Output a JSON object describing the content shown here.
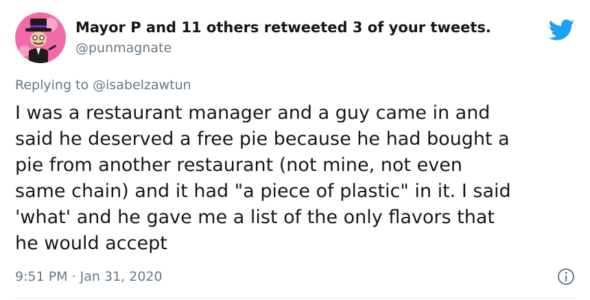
{
  "tweet": {
    "retweet_notice": "Mayor P and 11 others retweeted 3 of your tweets.",
    "handle": "@punmagnate",
    "replying_to": "Replying to @isabelzawtun",
    "text": "I was a restaurant manager and a guy came in and\nsaid he deserved a free pie because he had bought a\npie from another restaurant (not mine, not even\nsame chain) and it had \"a piece of plastic\" in it. I said\n'what' and he gave me a list of the only flavors that\nhe would accept",
    "timestamp": "9:51 PM · Jan 31, 2020"
  },
  "icons": {
    "avatar": "avatar",
    "brand": "twitter-bird-icon",
    "info": "info-icon"
  },
  "colors": {
    "brand_blue": "#1da1f2",
    "text_primary": "#14171a",
    "text_secondary": "#657786",
    "avatar_background": "#f06ba8"
  }
}
